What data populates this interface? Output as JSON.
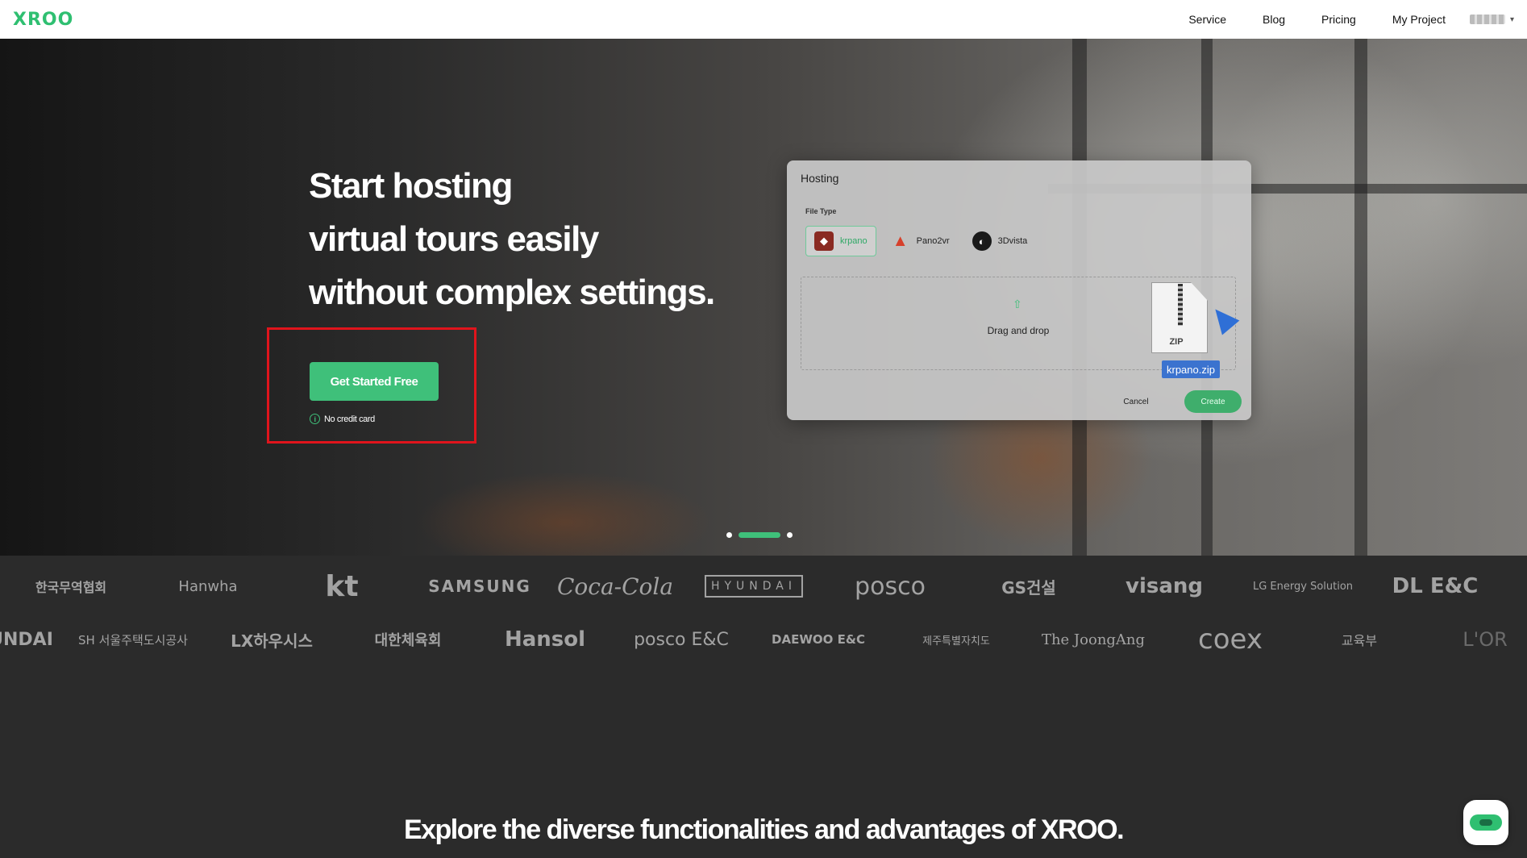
{
  "nav": {
    "logo": "XROO",
    "links": [
      "Service",
      "Blog",
      "Pricing",
      "My Project"
    ],
    "caret": "▾"
  },
  "hero": {
    "title_lines": [
      "Start hosting",
      "virtual tours easily",
      "without complex settings."
    ],
    "cta": "Get Started Free",
    "note": "No credit card",
    "info_icon": "i"
  },
  "dialog": {
    "title": "Hosting",
    "file_type_label": "File Type",
    "file_types": [
      "krpano",
      "Pano2vr",
      "3Dvista"
    ],
    "drop_text": "Drag and drop",
    "zip_label": "ZIP",
    "zip_filename": "krpano.zip",
    "cancel": "Cancel",
    "create": "Create"
  },
  "logos": {
    "row1": [
      "한국무역협회",
      "Hanwha",
      "kt",
      "SAMSUNG",
      "Coca-Cola",
      "HYUNDAI",
      "posco",
      "GS건설",
      "visang",
      "LG Energy Solution",
      "DL E&C"
    ],
    "row2": [
      "UNDAI",
      "SH 서울주택도시공사",
      "LX하우시스",
      "대한체육회",
      "Hansol",
      "posco E&C",
      "DAEWOO E&C",
      "제주특별자치도",
      "The JoongAng",
      "coex",
      "교육부",
      "L'OR"
    ]
  },
  "explore": {
    "heading": "Explore the diverse functionalities and advantages of XROO."
  },
  "colors": {
    "brand_green": "#3fc07a",
    "highlight_red": "#e0141c",
    "zip_tag_blue": "#3b73cf"
  },
  "icons": {
    "info": "info-icon",
    "upload": "upload-icon",
    "chat": "chat-icon",
    "caret": "chevron-down-icon"
  }
}
